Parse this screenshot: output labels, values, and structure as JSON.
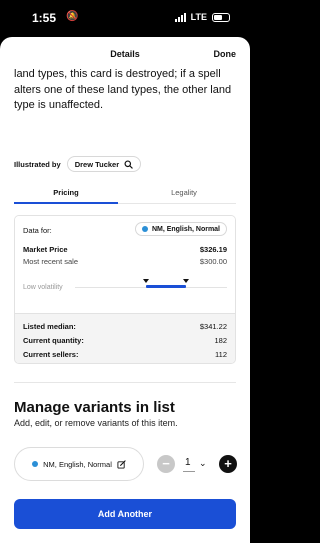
{
  "status_bar": {
    "time": "1:55",
    "network": "LTE",
    "battery_level": 0.55
  },
  "header": {
    "title": "Details",
    "done_label": "Done"
  },
  "card_text": {
    "rules_text": "land types, this card is destroyed; if a spell alters one of these land types, the other land type is unaffected."
  },
  "illustration": {
    "label": "Illustrated by",
    "artist": "Drew Tucker"
  },
  "tabs": [
    {
      "label": "Pricing",
      "active": true
    },
    {
      "label": "Legality",
      "active": false
    }
  ],
  "pricing": {
    "data_for_label": "Data for:",
    "variant": "NM, English, Normal",
    "market_price_label": "Market Price",
    "market_price": "$326.19",
    "most_recent_sale_label": "Most recent sale",
    "most_recent_sale": "$300.00",
    "volatility_label": "Low volatility",
    "volatility_range": [
      0.47,
      0.73
    ],
    "listed_median_label": "Listed median:",
    "listed_median": "$341.22",
    "current_quantity_label": "Current quantity:",
    "current_quantity": "182",
    "current_sellers_label": "Current sellers:",
    "current_sellers": "112"
  },
  "manage": {
    "title": "Manage variants in list",
    "subtitle": "Add, edit, or remove variants of this item.",
    "variant": "NM, English, Normal",
    "quantity": "1",
    "add_another_label": "Add Another"
  },
  "colors": {
    "accent": "#1a4fd6",
    "variant_dot": "#2b8fd6"
  }
}
